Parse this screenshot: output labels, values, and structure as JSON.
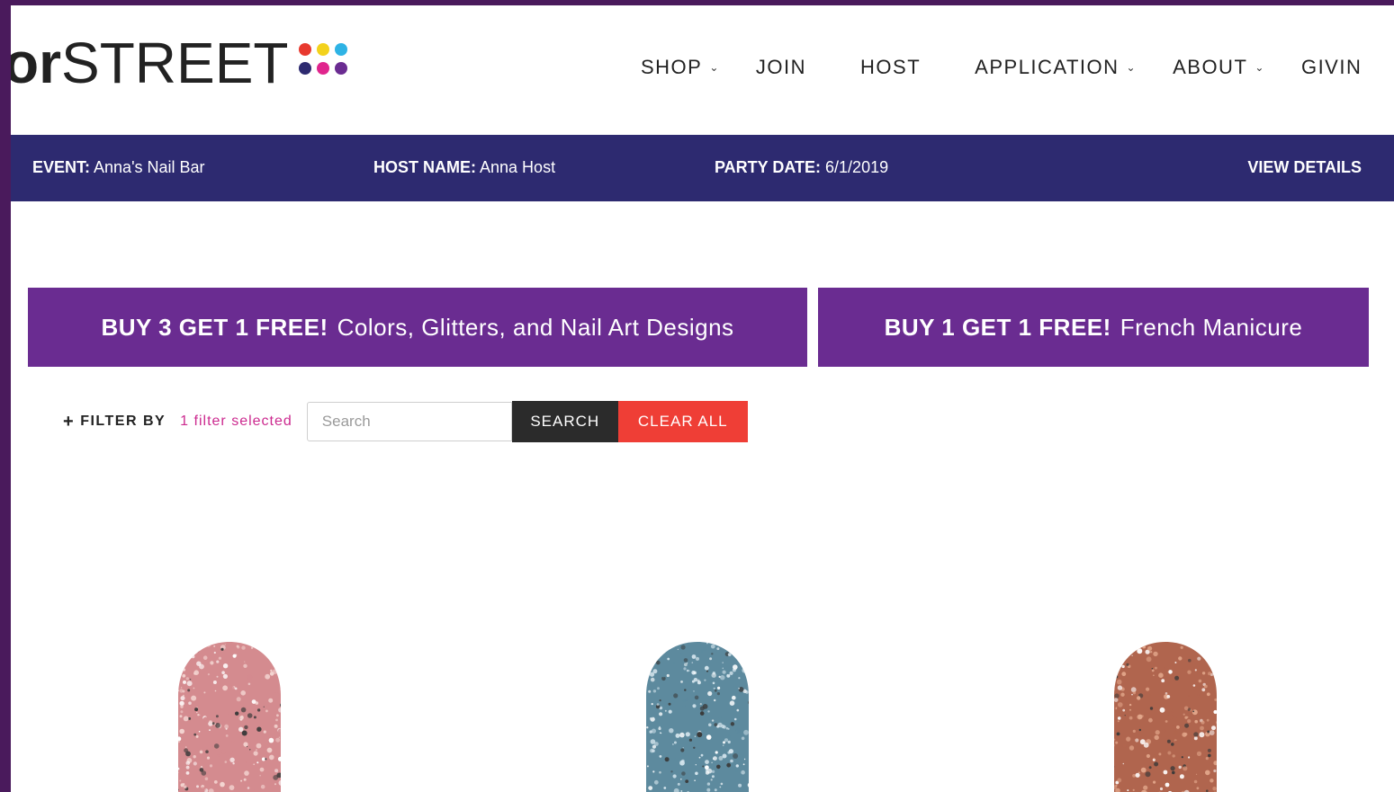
{
  "logo": {
    "text_light_prefix": "",
    "text_bold": "or",
    "text_light": "STREET",
    "dots": [
      "#e8392f",
      "#f3d21c",
      "#2eb3e5",
      "#2d2a70",
      "#e0258d",
      "#6a2c91"
    ]
  },
  "nav": {
    "shop": "SHOP",
    "join": "JOIN",
    "host": "HOST",
    "application": "APPLICATION",
    "about": "ABOUT",
    "giving": "GIVIN"
  },
  "event_bar": {
    "event_label": "EVENT:",
    "event_value": "Anna's Nail Bar",
    "host_label": "HOST NAME:",
    "host_value": "Anna Host",
    "date_label": "PARTY DATE:",
    "date_value": "6/1/2019",
    "view_details": "VIEW DETAILS"
  },
  "promos": [
    {
      "strong": "BUY 3 GET 1 FREE!",
      "text": "Colors, Glitters, and Nail Art Designs"
    },
    {
      "strong": "BUY 1 GET 1 FREE!",
      "text": "French Manicure"
    }
  ],
  "filter": {
    "label": "FILTER BY",
    "count": "1 filter selected",
    "search_placeholder": "Search",
    "search_button": "SEARCH",
    "clear_button": "CLEAR ALL"
  },
  "products": [
    {
      "swatch": "rose-gold-glitter",
      "base": "#d48b8f",
      "sparkle": "#f4d6d2"
    },
    {
      "swatch": "blue-silver-glitter",
      "base": "#5d8a9e",
      "sparkle": "#d6e6ee"
    },
    {
      "swatch": "copper-glitter",
      "base": "#b0654e",
      "sparkle": "#e2a68a"
    }
  ],
  "colors": {
    "accent_purple": "#6a2c91",
    "event_bar": "#2d2a70",
    "clear_red": "#ef3e36",
    "filter_pink": "#cc2a8f"
  }
}
